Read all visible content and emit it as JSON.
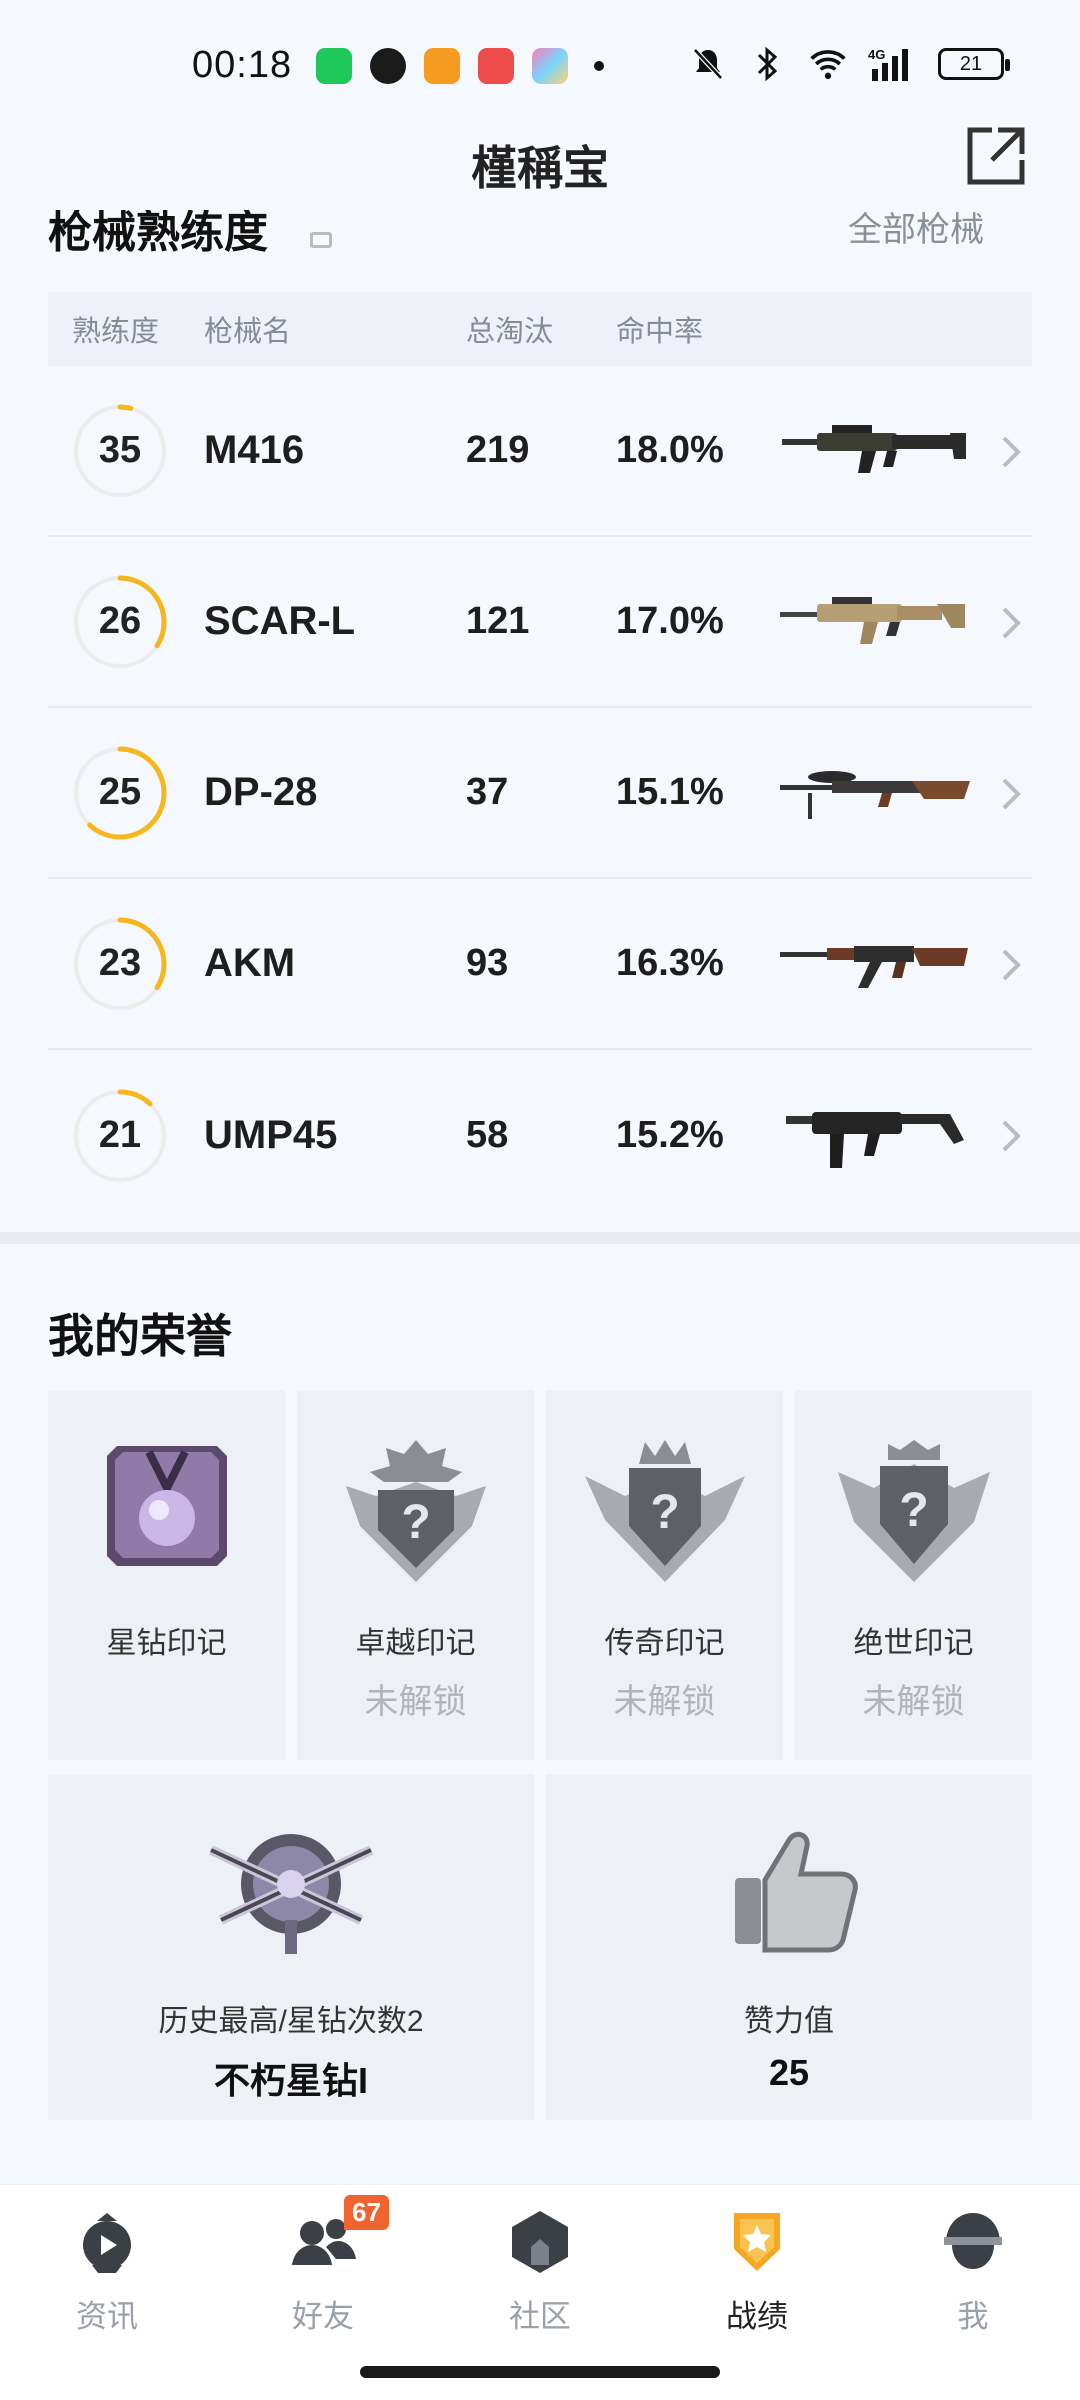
{
  "status_bar": {
    "time": "00:18",
    "battery": "21",
    "network": "4G",
    "apps": [
      "wechat-app-icon",
      "app-icon-2",
      "app-icon-3",
      "video-app-icon",
      "app-icon-5"
    ]
  },
  "header": {
    "title": "槿稱宝"
  },
  "weapon_section": {
    "title": "枪械熟练度",
    "link": "全部枪械",
    "columns": [
      "熟练度",
      "枪械名",
      "总淘汰",
      "命中率"
    ],
    "rows": [
      {
        "level": "35",
        "progress": 0.04,
        "name": "M416",
        "kills": "219",
        "accuracy": "18.0%"
      },
      {
        "level": "26",
        "progress": 0.34,
        "name": "SCAR-L",
        "kills": "121",
        "accuracy": "17.0%"
      },
      {
        "level": "25",
        "progress": 0.62,
        "name": "DP-28",
        "kills": "37",
        "accuracy": "15.1%"
      },
      {
        "level": "23",
        "progress": 0.34,
        "name": "AKM",
        "kills": "93",
        "accuracy": "16.3%"
      },
      {
        "level": "21",
        "progress": 0.12,
        "name": "UMP45",
        "kills": "58",
        "accuracy": "15.2%"
      }
    ]
  },
  "honors": {
    "title": "我的荣誉",
    "marks": [
      {
        "label": "星钻印记",
        "status": ""
      },
      {
        "label": "卓越印记",
        "status": "未解锁"
      },
      {
        "label": "传奇印记",
        "status": "未解锁"
      },
      {
        "label": "绝世印记",
        "status": "未解锁"
      }
    ],
    "history": {
      "label": "历史最高/星钻次数2",
      "value": "不朽星钻I"
    },
    "likes": {
      "label": "赞力值",
      "value": "25"
    }
  },
  "bottom_nav": {
    "items": [
      {
        "label": "资讯",
        "icon": "news-icon",
        "active": false
      },
      {
        "label": "好友",
        "icon": "friends-icon",
        "active": false,
        "badge": "67"
      },
      {
        "label": "社区",
        "icon": "community-icon",
        "active": false
      },
      {
        "label": "战绩",
        "icon": "record-icon",
        "active": true
      },
      {
        "label": "我",
        "icon": "profile-icon",
        "active": false
      }
    ]
  },
  "colors": {
    "accent": "#f5b71c",
    "badge": "#f0632e",
    "background": "#f5f8fc"
  }
}
